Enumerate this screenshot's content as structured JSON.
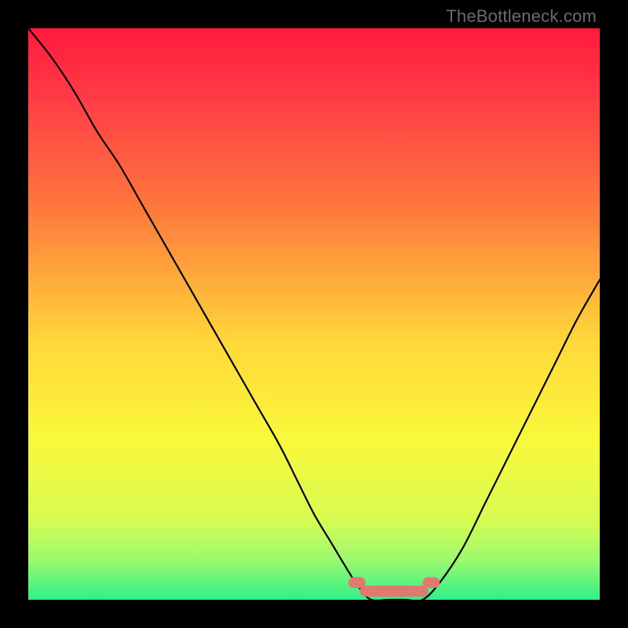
{
  "attribution": "TheBottleneck.com",
  "chart_data": {
    "type": "line",
    "title": "",
    "xlabel": "",
    "ylabel": "",
    "xlim": [
      0,
      100
    ],
    "ylim": [
      0,
      100
    ],
    "series": [
      {
        "name": "bottleneck-curve",
        "x": [
          0,
          4,
          8,
          12,
          16,
          20,
          24,
          28,
          32,
          36,
          40,
          44,
          47,
          50,
          53,
          56,
          58,
          60,
          63,
          66,
          69,
          72,
          76,
          80,
          84,
          88,
          92,
          96,
          100
        ],
        "y": [
          100,
          95,
          89,
          82,
          76,
          69,
          62,
          55,
          48,
          41,
          34,
          27,
          21,
          15,
          10,
          5,
          2,
          0,
          0,
          0,
          0,
          3,
          9,
          17,
          25,
          33,
          41,
          49,
          56
        ]
      }
    ],
    "annotations": [
      {
        "name": "optimal-band",
        "shape": "rounded-pill",
        "x_range": [
          58,
          70
        ],
        "y": 1.5,
        "color": "#e07a70"
      },
      {
        "name": "optimal-tick-left",
        "shape": "rounded-pill",
        "x_range": [
          56,
          59
        ],
        "y": 3,
        "color": "#e07a70"
      },
      {
        "name": "optimal-tick-right",
        "shape": "rounded-pill",
        "x_range": [
          69,
          72
        ],
        "y": 3,
        "color": "#e07a70"
      }
    ],
    "background_gradient": {
      "stops": [
        {
          "offset": 0.0,
          "color": "#ff1a3c"
        },
        {
          "offset": 0.12,
          "color": "#ff3b46"
        },
        {
          "offset": 0.32,
          "color": "#ff7a3c"
        },
        {
          "offset": 0.55,
          "color": "#ffd83a"
        },
        {
          "offset": 0.72,
          "color": "#f9f93a"
        },
        {
          "offset": 0.86,
          "color": "#d7fb52"
        },
        {
          "offset": 0.93,
          "color": "#9cf96e"
        },
        {
          "offset": 1.0,
          "color": "#2ef08a"
        }
      ]
    }
  }
}
